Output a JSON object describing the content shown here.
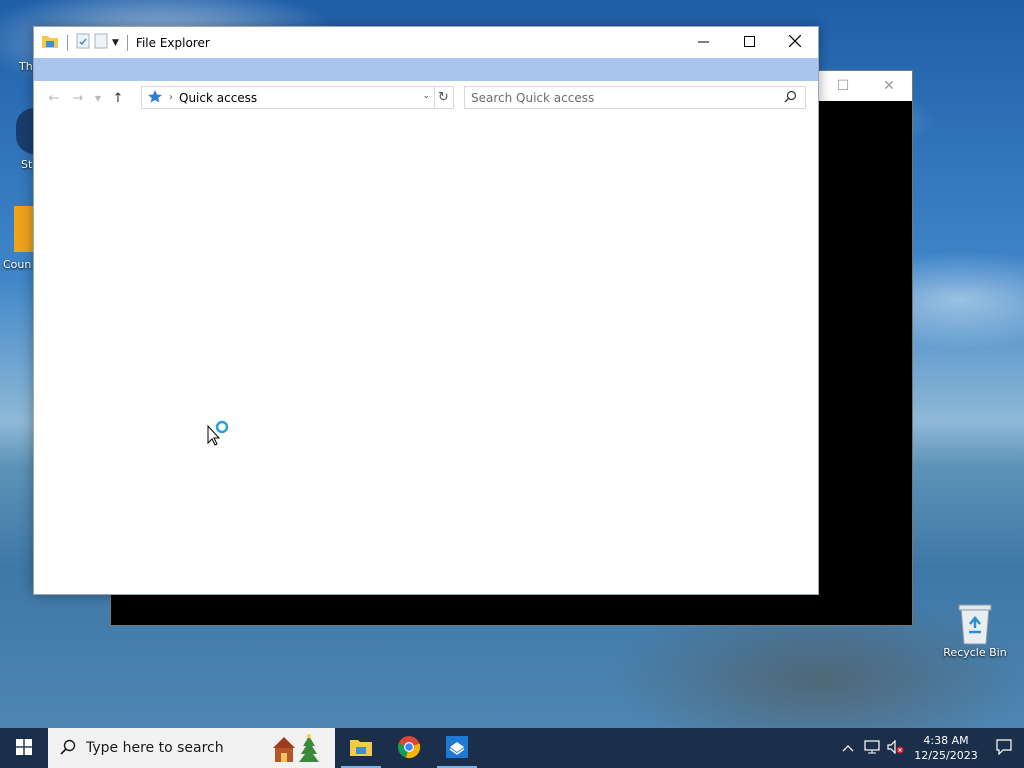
{
  "desktop": {
    "icons": [
      {
        "label": "Recycle Bin",
        "icon": "recycle-bin-icon"
      }
    ],
    "edge_labels": [
      "Th",
      "St",
      "Coun"
    ]
  },
  "explorer": {
    "title": "File Explorer",
    "address": {
      "location": "Quick access"
    },
    "search": {
      "placeholder": "Search Quick access"
    }
  },
  "taskbar": {
    "search_placeholder": "Type here to search",
    "apps": [
      {
        "name": "file-explorer",
        "icon": "folder-icon",
        "active": true
      },
      {
        "name": "chrome",
        "icon": "chrome-icon",
        "active": false
      },
      {
        "name": "app",
        "icon": "app-icon",
        "active": true
      }
    ],
    "clock": {
      "time": "4:38 AM",
      "date": "12/25/2023"
    }
  },
  "colors": {
    "taskbar_bg": "#1b2f4a",
    "ribbon_strip": "#a9c4ed",
    "accent": "#0078d7"
  }
}
